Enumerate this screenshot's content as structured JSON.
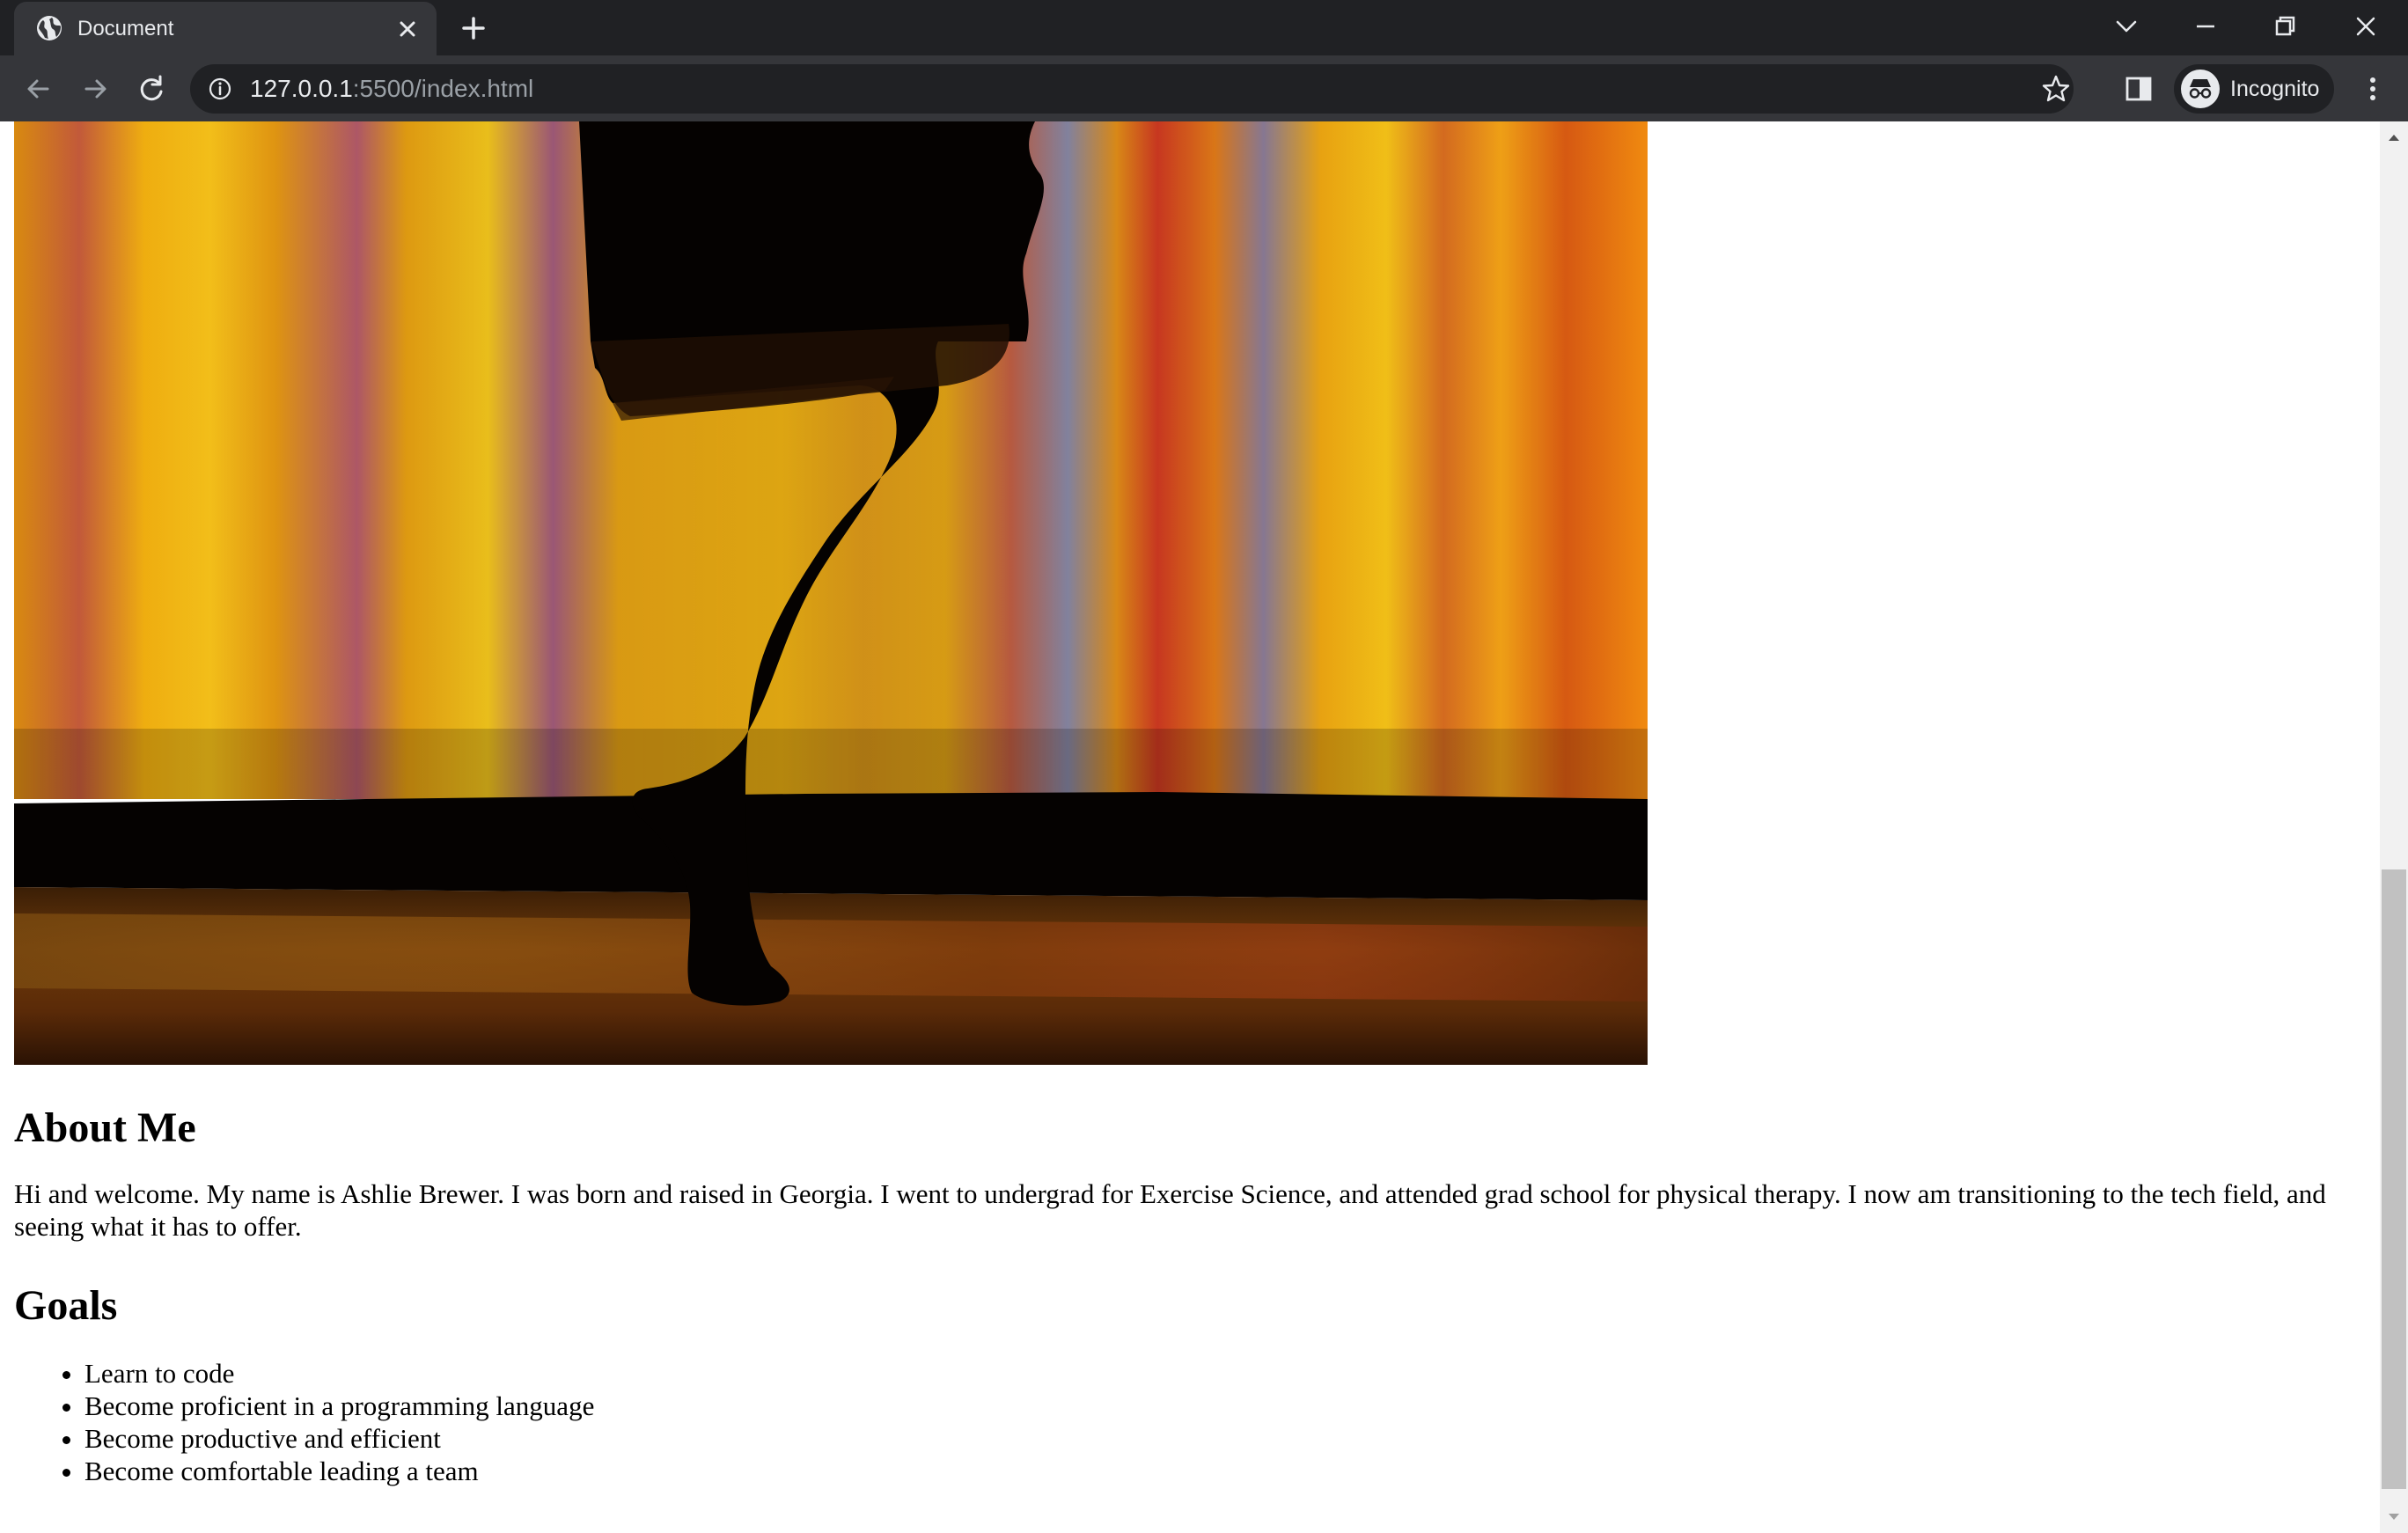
{
  "browser": {
    "tab_title": "Document",
    "url_host": "127.0.0.1",
    "url_rest": ":5500/index.html",
    "incognito_label": "Incognito"
  },
  "icons": {
    "favicon": "globe-icon",
    "tab_close": "close-icon",
    "new_tab": "plus-icon",
    "tab_search": "chevron-down-icon",
    "back": "arrow-left-icon",
    "forward": "arrow-right-icon",
    "reload": "reload-icon",
    "site_info": "info-icon",
    "bookmark": "star-icon",
    "side_panel": "side-panel-icon",
    "menu": "kebab-menu-icon"
  },
  "colors": {
    "tabstrip": "#202124",
    "toolbar": "#35363a",
    "omnibox": "#202124",
    "chrome_text": "#e8eaed",
    "url_muted": "#9aa0a6"
  },
  "page": {
    "about_heading": "About Me",
    "about_text": "Hi and welcome. My name is Ashlie Brewer. I was born and raised in Georgia. I went to undergrad for Exercise Science, and attended grad school for physical therapy. I now am transitioning to the tech field, and seeing what it has to offer.",
    "goals_heading": "Goals",
    "goals": [
      "Learn to code",
      "Become proficient in a programming language",
      "Become productive and efficient",
      "Become comfortable leading a team"
    ]
  }
}
